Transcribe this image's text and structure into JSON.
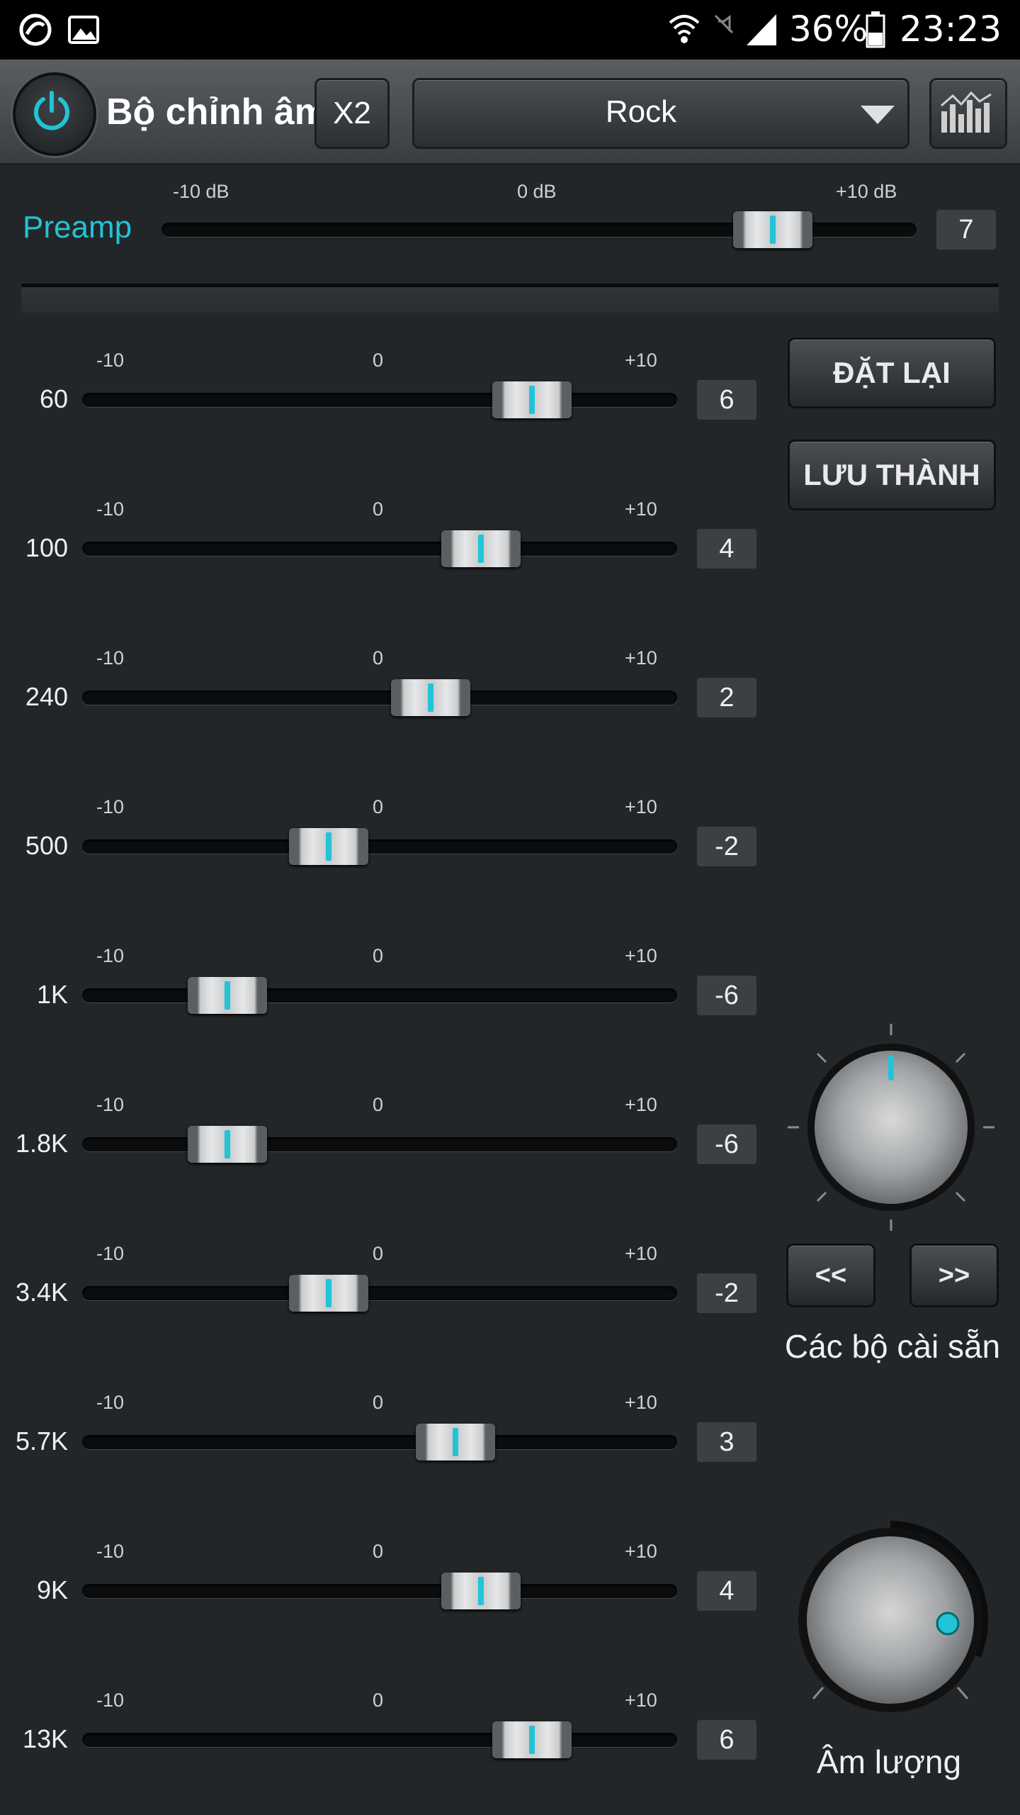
{
  "status_bar": {
    "battery": "36%",
    "time": "23:23"
  },
  "toolbar": {
    "title": "Bộ chỉnh âm",
    "x2_label": "X2",
    "preset": "Rock"
  },
  "preamp": {
    "label": "Preamp",
    "tick_min": "-10 dB",
    "tick_mid": "0 dB",
    "tick_max": "+10 dB",
    "value": "7",
    "level": 7
  },
  "band_ticks": {
    "min": "-10",
    "mid": "0",
    "max": "+10"
  },
  "bands": [
    {
      "label": "60",
      "value": "6",
      "level": 6
    },
    {
      "label": "100",
      "value": "4",
      "level": 4
    },
    {
      "label": "240",
      "value": "2",
      "level": 2
    },
    {
      "label": "500",
      "value": "-2",
      "level": -2
    },
    {
      "label": "1K",
      "value": "-6",
      "level": -6
    },
    {
      "label": "1.8K",
      "value": "-6",
      "level": -6
    },
    {
      "label": "3.4K",
      "value": "-2",
      "level": -2
    },
    {
      "label": "5.7K",
      "value": "3",
      "level": 3
    },
    {
      "label": "9K",
      "value": "4",
      "level": 4
    },
    {
      "label": "13K",
      "value": "6",
      "level": 6
    }
  ],
  "side": {
    "reset_label": "ĐẶT LẠI",
    "save_label": "LƯU THÀNH",
    "prev_label": "<<",
    "next_label": ">>",
    "presets_caption": "Các bộ cài sẵn",
    "volume_caption": "Âm lượng"
  },
  "colors": {
    "accent": "#20c4d6",
    "background": "#232629"
  }
}
